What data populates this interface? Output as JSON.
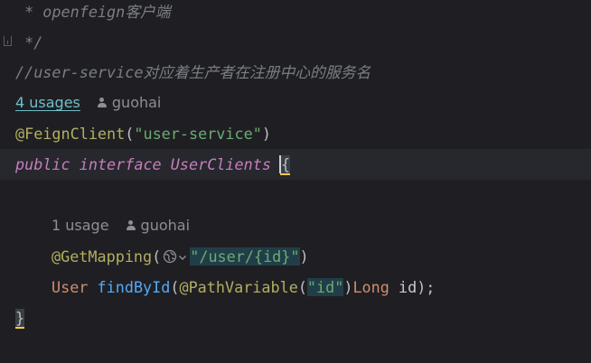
{
  "editor": {
    "lines": {
      "l1": {
        "text": " * openfeign客户端"
      },
      "l2": {
        "text": " */"
      },
      "l3": {
        "text": "//user-service对应着生产者在注册中心的服务名"
      },
      "l4": {
        "usages": "4 usages",
        "author": "guohai"
      },
      "l5": {
        "annotation": "@FeignClient",
        "open": "(",
        "string": "\"user-service\"",
        "close": ")"
      },
      "l6": {
        "kw_public": "public",
        "kw_interface": "interface",
        "classname": "UserClients",
        "brace": "{"
      },
      "l8": {
        "usages": "1 usage",
        "author": "guohai"
      },
      "l9": {
        "annotation": "@GetMapping",
        "open": "(",
        "string": "\"/user/{id}\"",
        "close": ")"
      },
      "l10": {
        "return_type": "User",
        "method": "findById",
        "open": "(",
        "annotation": "@PathVariable",
        "ann_open": "(",
        "string": "\"id\"",
        "ann_close": ")",
        "param_type": "Long",
        "param_name": "id",
        "close": ");"
      },
      "l11": {
        "brace": "}"
      }
    },
    "icons": {
      "globe": "globe-icon",
      "chevron": "chevron-down-icon",
      "user": "user-icon",
      "fold": "fold-marker-icon"
    },
    "colors": {
      "background": "#1f1f23",
      "current_line": "#26282e",
      "comment": "#7a7e85",
      "annotation": "#b3ae60",
      "string": "#6aab73",
      "keyword": "#cf8e6d",
      "method": "#56a8f5",
      "usage_link": "#6ec0c8"
    }
  }
}
